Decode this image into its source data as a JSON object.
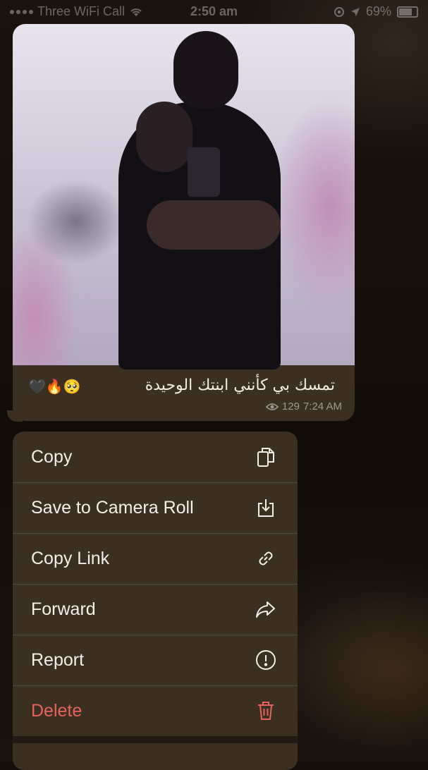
{
  "status_bar": {
    "carrier": "Three WiFi Call",
    "time": "2:50 am",
    "battery": "69%"
  },
  "message": {
    "caption_text": "تمسك بي كأنني ابنتك الوحيدة",
    "caption_emojis": "🖤🔥🥺",
    "views": "129",
    "time": "7:24 AM"
  },
  "context_menu": {
    "items": [
      {
        "label": "Copy",
        "icon": "copy-icon"
      },
      {
        "label": "Save to Camera Roll",
        "icon": "download-icon"
      },
      {
        "label": "Copy Link",
        "icon": "link-icon"
      },
      {
        "label": "Forward",
        "icon": "forward-icon"
      },
      {
        "label": "Report",
        "icon": "exclamation-circle-icon"
      },
      {
        "label": "Delete",
        "icon": "trash-icon"
      }
    ]
  },
  "colors": {
    "menu_bg": "#3b2f22",
    "delete": "#e8625c",
    "background": "#150e0a"
  }
}
